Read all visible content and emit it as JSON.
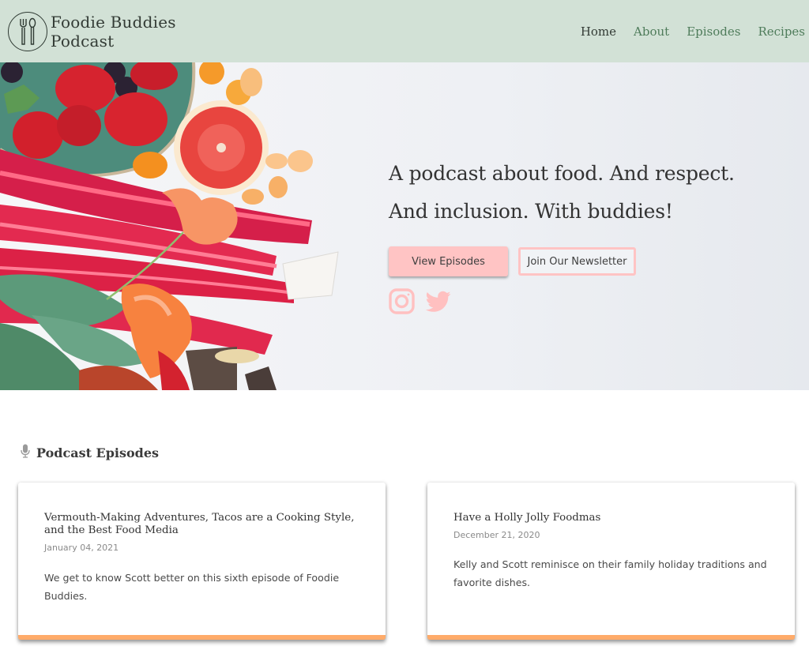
{
  "header": {
    "brand_line1": "Foodie Buddies",
    "brand_line2": "Podcast",
    "logo_icon": "fork-spoon-icon",
    "nav": [
      {
        "label": "Home",
        "active": true
      },
      {
        "label": "About",
        "active": false
      },
      {
        "label": "Episodes",
        "active": false
      },
      {
        "label": "Recipes",
        "active": false
      }
    ]
  },
  "hero": {
    "headline_line1": "A podcast about food. And respect.",
    "headline_line2": "And inclusion. With buddies!",
    "primary_button": "View Episodes",
    "secondary_button": "Join Our Newsletter",
    "social": [
      "instagram-icon",
      "twitter-icon"
    ],
    "image_alt": "Fruit, rhubarb, and flowers on a white table"
  },
  "episodes": {
    "heading": "Podcast Episodes",
    "heading_icon": "microphone-icon",
    "items": [
      {
        "title": "Vermouth-Making Adventures, Tacos are a Cooking Style, and the Best Food Media",
        "date": "January 04, 2021",
        "description": "We get to know Scott better on this sixth episode of Foodie Buddies."
      },
      {
        "title": "Have a Holly Jolly Foodmas",
        "date": "December 21, 2020",
        "description": "Kelly and Scott reminisce on their family holiday traditions and favorite dishes."
      }
    ]
  },
  "colors": {
    "header_bg": "#d2e1d6",
    "nav_link": "#4f7c5b",
    "nav_active": "#333b35",
    "button_pink": "#ffc4c4",
    "card_accent": "#ffab6a"
  }
}
